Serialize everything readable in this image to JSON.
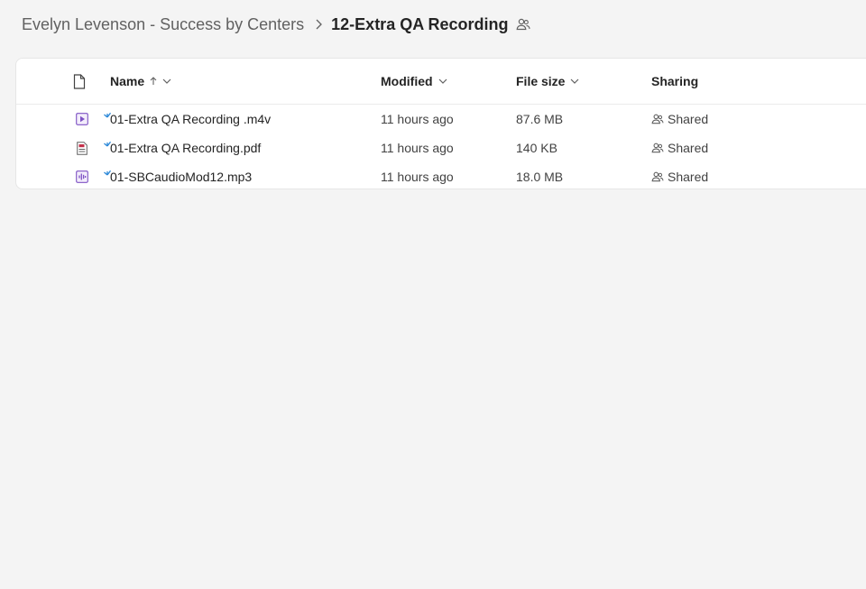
{
  "breadcrumb": {
    "parent": "Evelyn Levenson - Success by Centers",
    "current": "12-Extra QA Recording"
  },
  "columns": {
    "name": "Name",
    "modified": "Modified",
    "file_size": "File size",
    "sharing": "Sharing"
  },
  "files": [
    {
      "name": "01-Extra QA Recording .m4v",
      "modified": "11 hours ago",
      "size": "87.6 MB",
      "sharing": "Shared",
      "icon": "video-file-icon"
    },
    {
      "name": "01-Extra QA Recording.pdf",
      "modified": "11 hours ago",
      "size": "140 KB",
      "sharing": "Shared",
      "icon": "pdf-file-icon"
    },
    {
      "name": "01-SBCaudioMod12.mp3",
      "modified": "11 hours ago",
      "size": "18.0 MB",
      "sharing": "Shared",
      "icon": "audio-file-icon"
    }
  ],
  "colors": {
    "accent": "#7e52c4",
    "pdf": "#c4314b",
    "new_indicator": "#2b88d8"
  }
}
